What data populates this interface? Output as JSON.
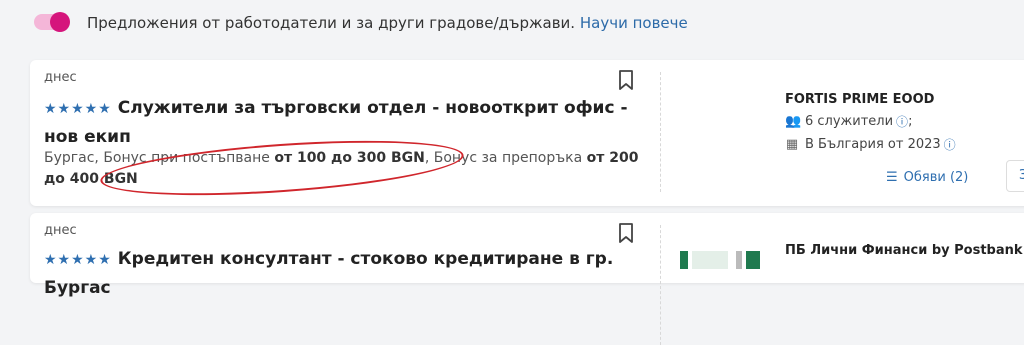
{
  "banner": {
    "text": "Предложения от работодатели и за други градове/държави.",
    "link": "Научи повече"
  },
  "jobs": [
    {
      "date": "днес",
      "stars": "★★★★★",
      "title": "Служители за търговски отдел - новооткрит офис - нов екип",
      "city": "Бургас",
      "bonus1_label": "Бонус при постъпване",
      "bonus1_value": "от 100 до 300 BGN",
      "bonus2_label": "Бонус за препоръка",
      "bonus2_value": "от 200 до 400 BGN",
      "company": "FORTIS PRIME EOOD",
      "employees": "6 служители",
      "since": "В България от 2023",
      "ads_label": "Обяви (2)",
      "follow_label": "За"
    },
    {
      "date": "днес",
      "stars": "★★★★★",
      "title": "Кредитен консултант - стоково кредитиране в гр. Бургас",
      "company": "ПБ Лични Финанси by Postbank / Юр"
    }
  ],
  "colors": {
    "accent": "#2f6fb0",
    "toggle": "#d5157c",
    "highlight": "#d0262c"
  }
}
